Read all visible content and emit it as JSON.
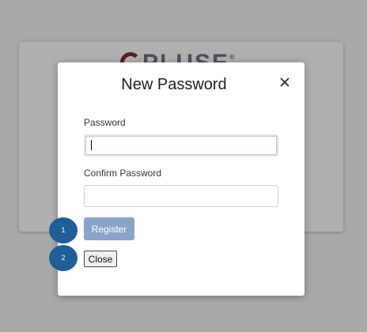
{
  "background": {
    "logo_text": "PLUSE",
    "logo_reg": "®"
  },
  "modal": {
    "title": "New Password",
    "close_icon": "close-icon",
    "password_label": "Password",
    "password_value": "",
    "confirm_label": "Confirm Password",
    "confirm_value": "",
    "register_label": "Register",
    "close_label": "Close"
  },
  "markers": [
    "1",
    "2"
  ],
  "colors": {
    "overlay": "#a9a9a9",
    "register_button": "#8aa4c9",
    "marker": "#1f5e96"
  }
}
